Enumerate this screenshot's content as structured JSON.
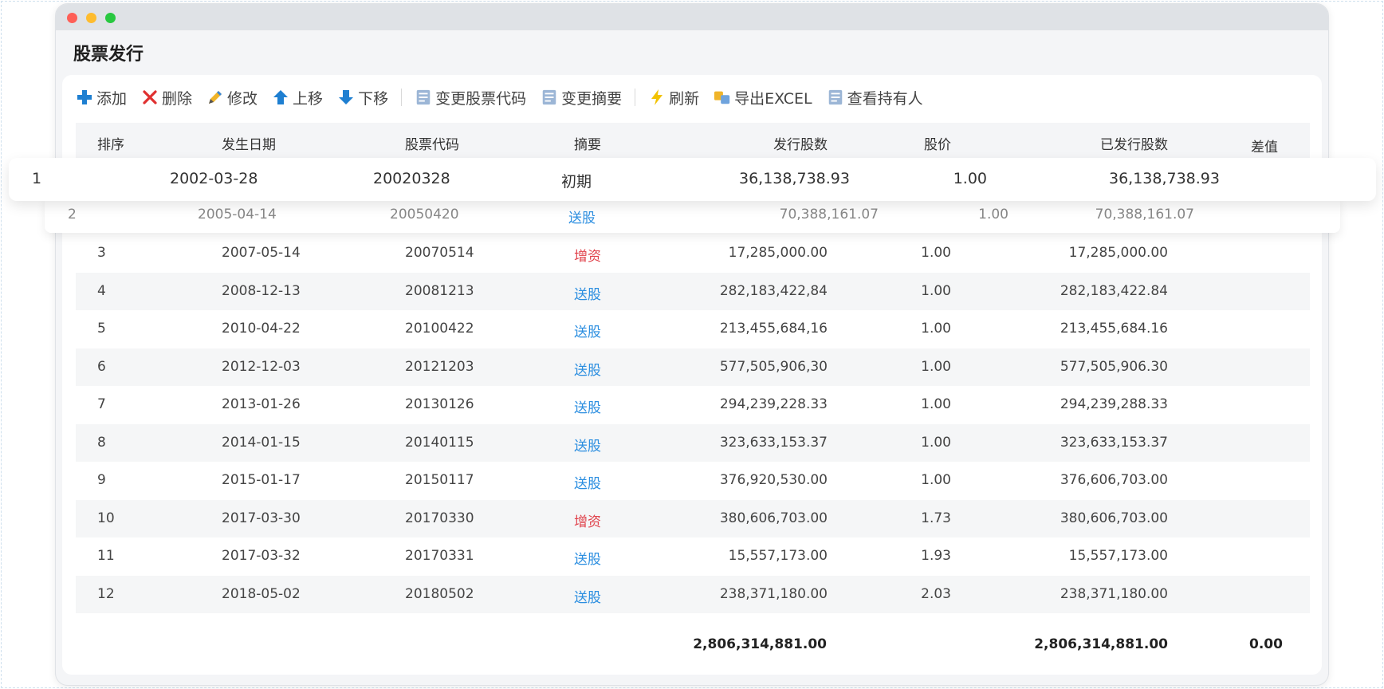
{
  "page": {
    "title": "股票发行"
  },
  "toolbar": {
    "items": [
      {
        "label": "添加",
        "icon": "plus-icon"
      },
      {
        "label": "删除",
        "icon": "close-icon"
      },
      {
        "label": "修改",
        "icon": "pencil-icon"
      },
      {
        "label": "上移",
        "icon": "arrow-up-icon"
      },
      {
        "label": "下移",
        "icon": "arrow-down-icon"
      },
      {
        "label": "变更股票代码",
        "icon": "document-icon"
      },
      {
        "label": "变更摘要",
        "icon": "document-icon"
      },
      {
        "label": "刷新",
        "icon": "lightning-icon"
      },
      {
        "label": "导出EXCEL",
        "icon": "export-icon"
      },
      {
        "label": "查看持有人",
        "icon": "document-icon"
      }
    ]
  },
  "table": {
    "headers": {
      "index": "排序",
      "date": "发生日期",
      "code": "股票代码",
      "summary": "摘要",
      "issued": "发行股数",
      "price": "股价",
      "total": "已发行股数",
      "diff": "差值"
    },
    "rows": [
      {
        "index": "1",
        "date": "2002-03-28",
        "code": "20020328",
        "summary": "初期",
        "issued": "36,138,738.93",
        "price": "1.00",
        "total": "36,138,738.93"
      },
      {
        "index": "2",
        "date": "2005-04-14",
        "code": "20050420",
        "summary": "送股",
        "issued": "70,388,161.07",
        "price": "1.00",
        "total": "70,388,161.07"
      },
      {
        "index": "3",
        "date": "2007-05-14",
        "code": "20070514",
        "summary": "增资",
        "issued": "17,285,000.00",
        "price": "1.00",
        "total": "17,285,000.00"
      },
      {
        "index": "4",
        "date": "2008-12-13",
        "code": "20081213",
        "summary": "送股",
        "issued": "282,183,422,84",
        "price": "1.00",
        "total": "282,183,422.84"
      },
      {
        "index": "5",
        "date": "2010-04-22",
        "code": "20100422",
        "summary": "送股",
        "issued": "213,455,684,16",
        "price": "1.00",
        "total": "213,455,684.16"
      },
      {
        "index": "6",
        "date": "2012-12-03",
        "code": "20121203",
        "summary": "送股",
        "issued": "577,505,906,30",
        "price": "1.00",
        "total": "577,505,906.30"
      },
      {
        "index": "7",
        "date": "2013-01-26",
        "code": "20130126",
        "summary": "送股",
        "issued": "294,239,228.33",
        "price": "1.00",
        "total": "294,239,288.33"
      },
      {
        "index": "8",
        "date": "2014-01-15",
        "code": "20140115",
        "summary": "送股",
        "issued": "323,633,153.37",
        "price": "1.00",
        "total": "323,633,153.37"
      },
      {
        "index": "9",
        "date": "2015-01-17",
        "code": "20150117",
        "summary": "送股",
        "issued": "376,920,530.00",
        "price": "1.00",
        "total": "376,606,703.00"
      },
      {
        "index": "10",
        "date": "2017-03-30",
        "code": "20170330",
        "summary": "增资",
        "issued": "380,606,703.00",
        "price": "1.73",
        "total": "380,606,703.00"
      },
      {
        "index": "11",
        "date": "2017-03-32",
        "code": "20170331",
        "summary": "送股",
        "issued": "15,557,173.00",
        "price": "1.93",
        "total": "15,557,173.00"
      },
      {
        "index": "12",
        "date": "2018-05-02",
        "code": "20180502",
        "summary": "送股",
        "issued": "238,371,180.00",
        "price": "2.03",
        "total": "238,371,180.00"
      }
    ],
    "footer": {
      "issued": "2,806,314,881.00",
      "total": "2,806,314,881.00",
      "diff": "0.00"
    }
  },
  "colors": {
    "send": "#2b8ee0",
    "add": "#e0424b",
    "toolbar_icon": "#1e7fd1"
  }
}
